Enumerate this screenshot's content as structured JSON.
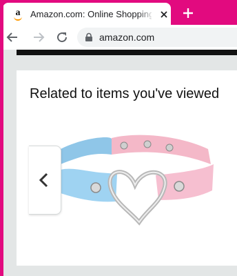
{
  "browser": {
    "tab": {
      "favicon": "amazon-favicon",
      "title": "Amazon.com: Online Shopping fo",
      "close_icon": "close-icon"
    },
    "new_tab_icon": "plus-icon",
    "nav": {
      "back_icon": "back-arrow-icon",
      "forward_icon": "forward-arrow-icon",
      "reload_icon": "reload-icon"
    },
    "address_bar": {
      "lock_icon": "lock-icon",
      "url": "amazon.com"
    },
    "accent_color": "#e20a7f"
  },
  "page": {
    "section_title": "Related to items you've viewed",
    "carousel": {
      "prev_icon": "chevron-left-icon",
      "product_image": "pastel heart choker necklace"
    }
  }
}
